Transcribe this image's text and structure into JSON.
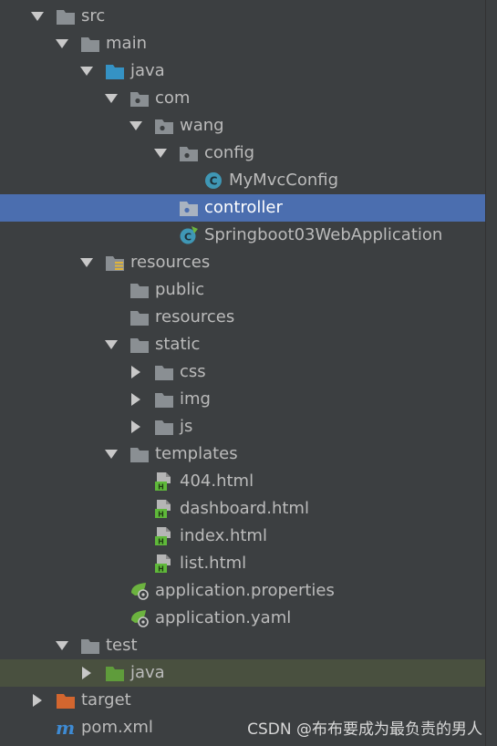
{
  "tree": {
    "src": "src",
    "main": "main",
    "java_main": "java",
    "com": "com",
    "wang": "wang",
    "config": "config",
    "mymvcconfig": "MyMvcConfig",
    "controller": "controller",
    "springboot_app": "Springboot03WebApplication",
    "resources": "resources",
    "public": "public",
    "resources_sub": "resources",
    "static": "static",
    "css": "css",
    "img": "img",
    "js": "js",
    "templates": "templates",
    "file_404": "404.html",
    "file_dashboard": "dashboard.html",
    "file_index": "index.html",
    "file_list": "list.html",
    "app_properties": "application.properties",
    "app_yaml": "application.yaml",
    "test": "test",
    "java_test": "java",
    "target": "target",
    "pom": "pom.xml"
  },
  "watermark": "CSDN @布布要成为最负责的男人",
  "colors": {
    "background": "#3c3f41",
    "selection": "#4b6eaf",
    "folder": "#8a8f93",
    "source_folder": "#3592c4",
    "test_folder": "#5f9c3b",
    "excluded_folder": "#d3662f",
    "class_icon": "#3f97b5",
    "html_icon_badge": "#5fb93a",
    "maven": "#3e8bd4"
  }
}
